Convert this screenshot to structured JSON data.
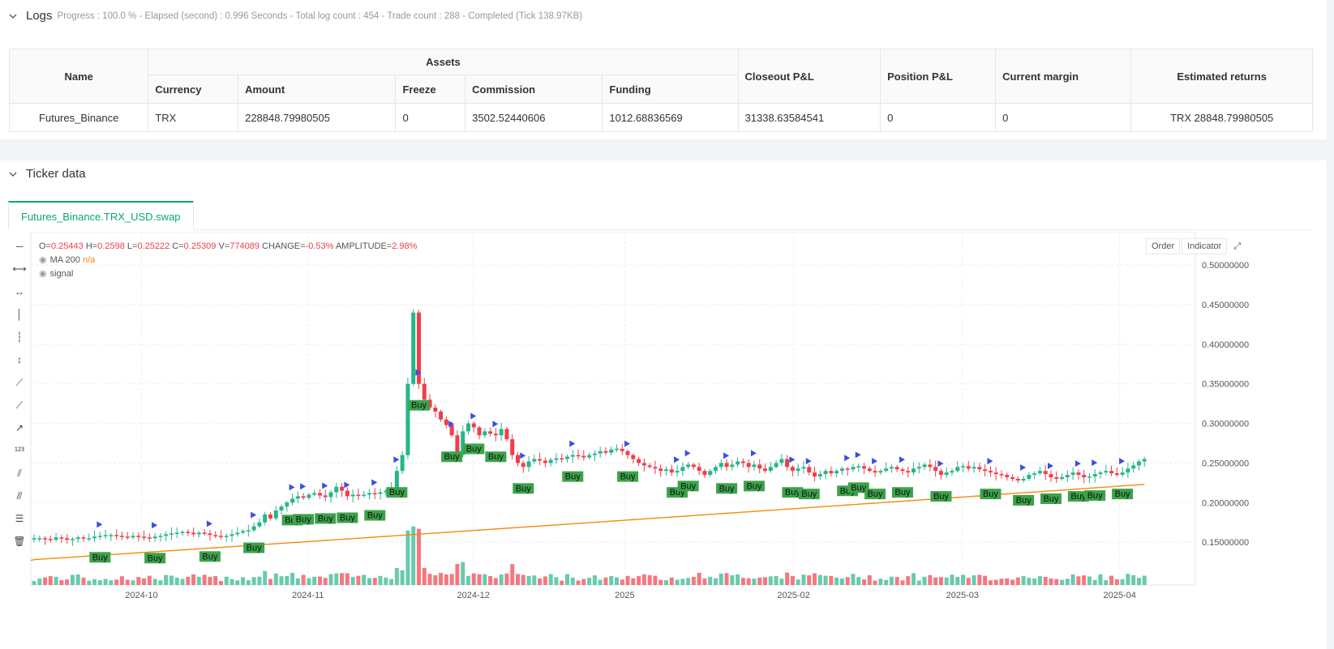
{
  "logs": {
    "title": "Logs",
    "status": "Progress : 100.0 % - Elapsed (second) : 0.996  Seconds - Total log count : 454 - Trade count : 288 - Completed (Tick 138.97KB)",
    "table": {
      "name_header": "Name",
      "assets_header": "Assets",
      "sub_headers": [
        "Currency",
        "Amount",
        "Freeze",
        "Commission",
        "Funding"
      ],
      "closeout_header": "Closeout P&L",
      "position_header": "Position P&L",
      "margin_header": "Current margin",
      "returns_header": "Estimated returns",
      "row": {
        "name": "Futures_Binance",
        "currency": "TRX",
        "amount": "228848.79980505",
        "freeze": "0",
        "commission": "3502.52440606",
        "funding": "1012.68836569",
        "closeout": "31338.63584541",
        "position": "0",
        "margin": "0",
        "returns": "TRX 28848.79980505"
      }
    }
  },
  "ticker": {
    "title": "Ticker data",
    "tab": "Futures_Binance.TRX_USD.swap",
    "legend": {
      "ohlc_prefix_o": "O=",
      "o": "0.25443",
      "h_prefix": "H=",
      "h": "0.2598",
      "l_prefix": "L=",
      "l": "0.25222",
      "c_prefix": "C=",
      "c": "0.25309",
      "v_prefix": "V=",
      "v": "774089",
      "change_prefix": "CHANGE=",
      "change": "-0.53%",
      "amp_prefix": "AMPLITUDE=",
      "amp": "2.98%",
      "ma_label": "MA 200",
      "ma_value": "n/a",
      "signal_label": "signal"
    },
    "buttons": {
      "order": "Order",
      "indicator": "Indicator"
    },
    "icons": [
      "horizontal-line-icon",
      "horizontal-ray-icon",
      "extended-line-icon",
      "vertical-line-icon",
      "vertical-segment-icon",
      "vertical-ray-icon",
      "trend-line-icon",
      "ray-icon",
      "arrow-line-icon",
      "price-label-icon",
      "parallel-channel-icon",
      "fib-icon",
      "multi-line-icon",
      "trash-icon"
    ],
    "colors": {
      "up": "#26b58a",
      "down": "#ef3e4a",
      "ma": "#f58a0b",
      "buy_box": "#3ca34a",
      "marker": "#3a4fe0"
    }
  },
  "chart_data": {
    "type": "candlestick",
    "y_ticks": [
      "0.50000000",
      "0.45000000",
      "0.40000000",
      "0.35000000",
      "0.30000000",
      "0.25000000",
      "0.20000000",
      "0.15000000"
    ],
    "y_tick_values": [
      0.5,
      0.45,
      0.4,
      0.35,
      0.3,
      0.25,
      0.2,
      0.15
    ],
    "x_ticks": [
      "2024-10",
      "2024-11",
      "2024-12",
      "2025",
      "2025-02",
      "2025-03",
      "2025-04"
    ],
    "ylim": [
      0.1,
      0.515
    ],
    "closes": [
      0.155,
      0.155,
      0.154,
      0.153,
      0.156,
      0.155,
      0.153,
      0.154,
      0.156,
      0.155,
      0.155,
      0.157,
      0.158,
      0.159,
      0.159,
      0.158,
      0.157,
      0.156,
      0.158,
      0.157,
      0.156,
      0.155,
      0.157,
      0.158,
      0.16,
      0.161,
      0.162,
      0.163,
      0.162,
      0.16,
      0.162,
      0.161,
      0.159,
      0.158,
      0.157,
      0.158,
      0.16,
      0.162,
      0.164,
      0.165,
      0.17,
      0.175,
      0.185,
      0.18,
      0.19,
      0.195,
      0.2,
      0.205,
      0.208,
      0.206,
      0.21,
      0.212,
      0.209,
      0.207,
      0.213,
      0.22,
      0.215,
      0.208,
      0.21,
      0.209,
      0.21,
      0.212,
      0.211,
      0.213,
      0.215,
      0.218,
      0.24,
      0.26,
      0.35,
      0.44,
      0.35,
      0.33,
      0.32,
      0.315,
      0.305,
      0.298,
      0.285,
      0.26,
      0.29,
      0.3,
      0.295,
      0.285,
      0.29,
      0.287,
      0.285,
      0.293,
      0.28,
      0.26,
      0.25,
      0.245,
      0.252,
      0.255,
      0.253,
      0.25,
      0.254,
      0.256,
      0.255,
      0.258,
      0.26,
      0.259,
      0.257,
      0.26,
      0.262,
      0.265,
      0.263,
      0.267,
      0.268,
      0.265,
      0.26,
      0.255,
      0.25,
      0.247,
      0.245,
      0.243,
      0.24,
      0.242,
      0.238,
      0.24,
      0.245,
      0.248,
      0.245,
      0.24,
      0.235,
      0.24,
      0.245,
      0.25,
      0.245,
      0.248,
      0.252,
      0.25,
      0.245,
      0.248,
      0.243,
      0.24,
      0.245,
      0.25,
      0.255,
      0.245,
      0.24,
      0.243,
      0.245,
      0.238,
      0.233,
      0.236,
      0.24,
      0.237,
      0.24,
      0.243,
      0.242,
      0.245,
      0.246,
      0.243,
      0.24,
      0.238,
      0.24,
      0.243,
      0.245,
      0.242,
      0.24,
      0.238,
      0.243,
      0.245,
      0.248,
      0.245,
      0.24,
      0.235,
      0.238,
      0.24,
      0.245,
      0.246,
      0.243,
      0.245,
      0.242,
      0.24,
      0.238,
      0.236,
      0.235,
      0.232,
      0.23,
      0.228,
      0.23,
      0.235,
      0.237,
      0.24,
      0.236,
      0.232,
      0.23,
      0.232,
      0.235,
      0.238,
      0.235,
      0.232,
      0.233,
      0.236,
      0.238,
      0.24,
      0.237,
      0.235,
      0.238,
      0.243,
      0.247,
      0.252,
      0.255
    ]
  }
}
